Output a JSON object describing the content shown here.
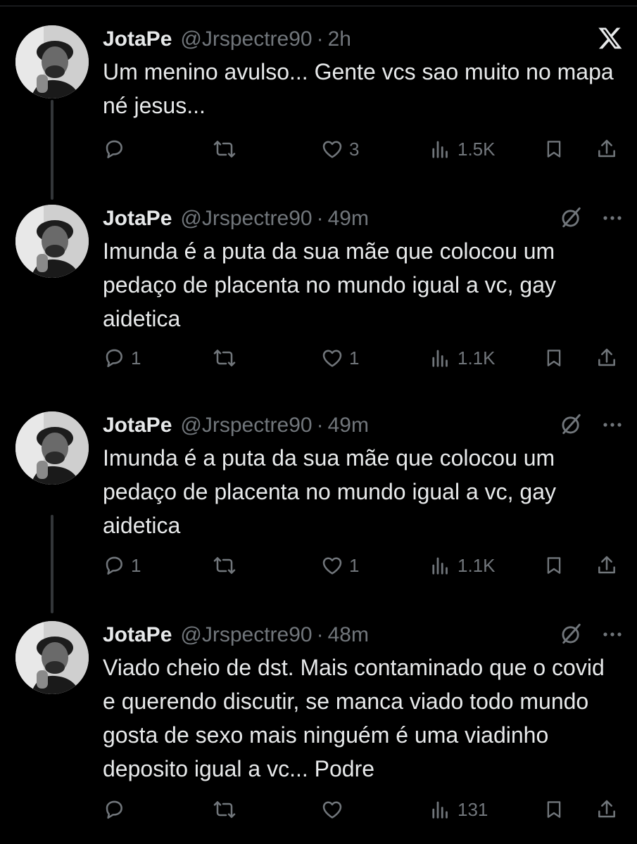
{
  "tweets": [
    {
      "name": "JotaPe",
      "handle": "@Jrspectre90",
      "dot": "·",
      "time": "2h",
      "text": "Um menino avulso... Gente vcs sao muito no mapa né jesus...",
      "replies": "",
      "retweets": "",
      "likes": "3",
      "views": "1.5K",
      "corner_icon": "x-logo-icon"
    },
    {
      "name": "JotaPe",
      "handle": "@Jrspectre90",
      "dot": "·",
      "time": "49m",
      "text": "Imunda é a puta da sua mãe que colocou um pedaço de placenta no mundo igual a vc, gay aidetica",
      "replies": "1",
      "retweets": "",
      "likes": "1",
      "views": "1.1K",
      "corner_icon": "grok-icon"
    },
    {
      "name": "JotaPe",
      "handle": "@Jrspectre90",
      "dot": "·",
      "time": "49m",
      "text": "Imunda é a puta da sua mãe que colocou um pedaço de placenta no mundo igual a vc, gay aidetica",
      "replies": "1",
      "retweets": "",
      "likes": "1",
      "views": "1.1K",
      "corner_icon": "grok-icon"
    },
    {
      "name": "JotaPe",
      "handle": "@Jrspectre90",
      "dot": "·",
      "time": "48m",
      "text": "Viado cheio de dst. Mais contaminado que o covid e querendo discutir, se manca viado todo mundo gosta de sexo mais ninguém é uma viadinho deposito igual a vc... Podre",
      "replies": "",
      "retweets": "",
      "likes": "",
      "views": "131",
      "corner_icon": "grok-icon"
    }
  ],
  "colors": {
    "background": "#000000",
    "text": "#e7e9ea",
    "secondary": "#71767b",
    "thread_line": "#333639"
  }
}
